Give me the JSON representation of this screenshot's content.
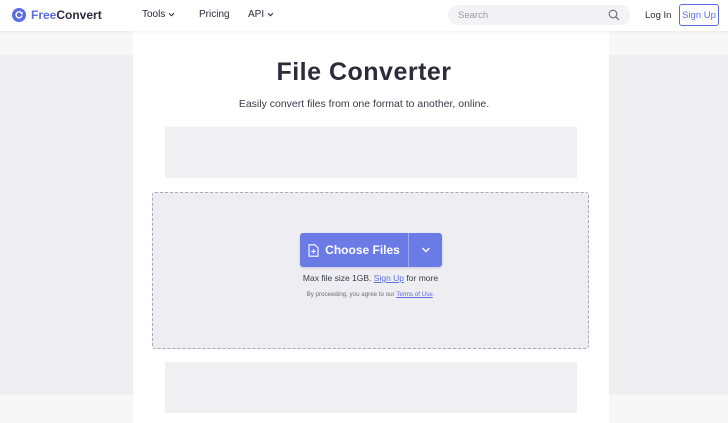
{
  "header": {
    "brand": {
      "prefix": "Free",
      "suffix": "Convert"
    },
    "nav": {
      "tools": "Tools",
      "pricing": "Pricing",
      "api": "API"
    },
    "search": {
      "placeholder": "Search"
    },
    "login": "Log In",
    "signup": "Sign Up"
  },
  "hero": {
    "title": "File Converter",
    "subtitle": "Easily convert files from one format to another, online."
  },
  "upload": {
    "button_label": "Choose Files",
    "max_size_prefix": "Max file size 1GB.",
    "max_size_link": "Sign Up",
    "max_size_suffix": "for more",
    "terms_prefix": "By proceeding, you agree to our",
    "terms_link": "Terms of Use",
    "terms_suffix": "."
  },
  "colors": {
    "accent": "#5b6ee1",
    "button": "#6b7be6",
    "dropzone_bg": "#eeeef2",
    "dropzone_border": "#a8a7c0"
  }
}
